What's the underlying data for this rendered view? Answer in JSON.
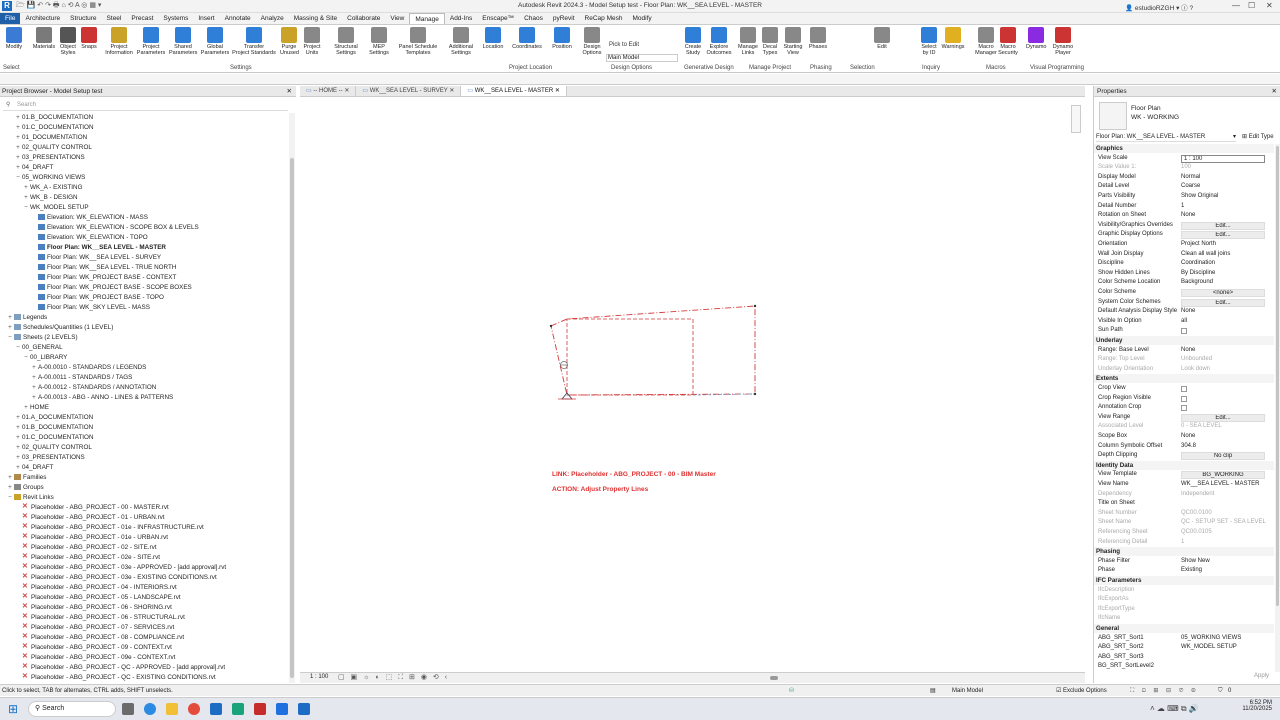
{
  "app": {
    "title": "Autodesk Revit 2024.3 - Model Setup test - Floor Plan: WK__SEA LEVEL - MASTER",
    "user": "estudioRZGH",
    "logo": "R"
  },
  "ribbon_tabs": [
    "File",
    "Architecture",
    "Structure",
    "Steel",
    "Precast",
    "Systems",
    "Insert",
    "Annotate",
    "Analyze",
    "Massing & Site",
    "Collaborate",
    "View",
    "Manage",
    "Add-Ins",
    "Enscape™",
    "Chaos",
    "pyRevit",
    "ReCap Mesh",
    "Modify"
  ],
  "ribbon_active": "Manage",
  "ribbon_buttons": [
    {
      "label": "Modify",
      "color": "#3a7bd5"
    },
    {
      "label": "Materials",
      "color": "#7a7a7a"
    },
    {
      "label": "Object\nStyles",
      "color": "#555"
    },
    {
      "label": "Snaps",
      "color": "#c33"
    },
    {
      "label": "Project\nInformation",
      "color": "#c9a227"
    },
    {
      "label": "Project\nParameters",
      "color": "#2f7ed8"
    },
    {
      "label": "Shared\nParameters",
      "color": "#2f7ed8"
    },
    {
      "label": "Global\nParameters",
      "color": "#2f7ed8"
    },
    {
      "label": "Transfer\nProject Standards",
      "color": "#2f7ed8"
    },
    {
      "label": "Purge\nUnused",
      "color": "#c9a227"
    },
    {
      "label": "Project\nUnits",
      "color": "#888"
    },
    {
      "label": "Structural\nSettings",
      "color": "#888"
    },
    {
      "label": "MEP\nSettings",
      "color": "#888"
    },
    {
      "label": "Panel Schedule\nTemplates",
      "color": "#888"
    },
    {
      "label": "Additional\nSettings",
      "color": "#888"
    },
    {
      "label": "Location",
      "color": "#2f7ed8"
    },
    {
      "label": "Coordinates",
      "color": "#2f7ed8"
    },
    {
      "label": "Position",
      "color": "#2f7ed8"
    },
    {
      "label": "Design\nOptions",
      "color": "#888"
    },
    {
      "label": "Create\nStudy",
      "color": "#2f7ed8"
    },
    {
      "label": "Explore\nOutcomes",
      "color": "#2f7ed8"
    },
    {
      "label": "Manage\nLinks",
      "color": "#888"
    },
    {
      "label": "Decal\nTypes",
      "color": "#888"
    },
    {
      "label": "Starting\nView",
      "color": "#888"
    },
    {
      "label": "Phases",
      "color": "#888"
    },
    {
      "label": "Edit",
      "color": "#888"
    },
    {
      "label": "Select\nby ID",
      "color": "#2f7ed8"
    },
    {
      "label": "Warnings",
      "color": "#e0b020"
    },
    {
      "label": "Macro\nManager",
      "color": "#888"
    },
    {
      "label": "Macro\nSecurity",
      "color": "#c33"
    },
    {
      "label": "Dynamo",
      "color": "#8a2be2"
    },
    {
      "label": "Dynamo\nPlayer",
      "color": "#c33"
    }
  ],
  "ribbon_extra": {
    "pick_to_edit": "Pick to Edit",
    "main_model": "Main Model"
  },
  "ribbon_panels": [
    "Select",
    "Settings",
    "Project Location",
    "Design Options",
    "Generative Design",
    "Manage Project",
    "Phasing",
    "Selection",
    "Inquiry",
    "Macros",
    "Visual Programming"
  ],
  "project_browser": {
    "title": "Project Browser - Model Setup test",
    "search_placeholder": "Search",
    "tree": [
      {
        "t": "01.B_DOCUMENTATION",
        "d": 1,
        "g": "+"
      },
      {
        "t": "01.C_DOCUMENTATION",
        "d": 1,
        "g": "+"
      },
      {
        "t": "01_DOCUMENTATION",
        "d": 1,
        "g": "+"
      },
      {
        "t": "02_QUALITY CONTROL",
        "d": 1,
        "g": "+"
      },
      {
        "t": "03_PRESENTATIONS",
        "d": 1,
        "g": "+"
      },
      {
        "t": "04_DRAFT",
        "d": 1,
        "g": "+"
      },
      {
        "t": "05_WORKING VIEWS",
        "d": 1,
        "g": "−"
      },
      {
        "t": "WK_A - EXISTING",
        "d": 2,
        "g": "+"
      },
      {
        "t": "WK_B - DESIGN",
        "d": 2,
        "g": "+"
      },
      {
        "t": "WK_MODEL SETUP",
        "d": 2,
        "g": "−"
      },
      {
        "t": "Elevation: WK_ELEVATION - MASS",
        "d": 4,
        "i": "view"
      },
      {
        "t": "Elevation: WK_ELEVATION - SCOPE BOX & LEVELS",
        "d": 4,
        "i": "view"
      },
      {
        "t": "Elevation: WK_ELEVATION - TOPO",
        "d": 4,
        "i": "view"
      },
      {
        "t": "Floor Plan: WK__SEA LEVEL - MASTER",
        "d": 4,
        "i": "view",
        "b": true
      },
      {
        "t": "Floor Plan: WK__SEA LEVEL - SURVEY",
        "d": 4,
        "i": "view"
      },
      {
        "t": "Floor Plan: WK__SEA LEVEL - TRUE NORTH",
        "d": 4,
        "i": "view"
      },
      {
        "t": "Floor Plan: WK_PROJECT BASE - CONTEXT",
        "d": 4,
        "i": "view"
      },
      {
        "t": "Floor Plan: WK_PROJECT BASE - SCOPE BOXES",
        "d": 4,
        "i": "view"
      },
      {
        "t": "Floor Plan: WK_PROJECT BASE - TOPO",
        "d": 4,
        "i": "view"
      },
      {
        "t": "Floor Plan: WK_SKY LEVEL - MASS",
        "d": 4,
        "i": "view"
      },
      {
        "t": "Legends",
        "d": 0,
        "g": "+",
        "i": "legend"
      },
      {
        "t": "Schedules/Quantities (1 LEVEL)",
        "d": 0,
        "g": "+",
        "i": "sched"
      },
      {
        "t": "Sheets (2 LEVELS)",
        "d": 0,
        "g": "−",
        "i": "sheet"
      },
      {
        "t": "00_GENERAL",
        "d": 1,
        "g": "−"
      },
      {
        "t": "00_LIBRARY",
        "d": 2,
        "g": "−"
      },
      {
        "t": "A-00.0010 - STANDARDS / LEGENDS",
        "d": 3,
        "g": "+"
      },
      {
        "t": "A-00.0011 - STANDARDS / TAGS",
        "d": 3,
        "g": "+"
      },
      {
        "t": "A-00.0012 - STANDARDS / ANNOTATION",
        "d": 3,
        "g": "+"
      },
      {
        "t": "A-00.0013 - ABG - ANNO - LINES & PATTERNS",
        "d": 3,
        "g": "+"
      },
      {
        "t": "HOME",
        "d": 2,
        "g": "+"
      },
      {
        "t": "01.A_DOCUMENTATION",
        "d": 1,
        "g": "+"
      },
      {
        "t": "01.B_DOCUMENTATION",
        "d": 1,
        "g": "+"
      },
      {
        "t": "01.C_DOCUMENTATION",
        "d": 1,
        "g": "+"
      },
      {
        "t": "02_QUALITY CONTROL",
        "d": 1,
        "g": "+"
      },
      {
        "t": "03_PRESENTATIONS",
        "d": 1,
        "g": "+"
      },
      {
        "t": "04_DRAFT",
        "d": 1,
        "g": "+"
      },
      {
        "t": "Families",
        "d": 0,
        "g": "+",
        "i": "fam"
      },
      {
        "t": "Groups",
        "d": 0,
        "g": "+",
        "i": "grp"
      },
      {
        "t": "Revit Links",
        "d": 0,
        "g": "−",
        "i": "link"
      },
      {
        "t": "Placeholder - ABG_PROJECT - 00 - MASTER.rvt",
        "d": 2,
        "i": "x"
      },
      {
        "t": "Placeholder - ABG_PROJECT - 01 - URBAN.rvt",
        "d": 2,
        "i": "x"
      },
      {
        "t": "Placeholder - ABG_PROJECT - 01e - INFRASTRUCTURE.rvt",
        "d": 2,
        "i": "x"
      },
      {
        "t": "Placeholder - ABG_PROJECT - 01e - URBAN.rvt",
        "d": 2,
        "i": "x"
      },
      {
        "t": "Placeholder - ABG_PROJECT - 02 - SITE.rvt",
        "d": 2,
        "i": "x"
      },
      {
        "t": "Placeholder - ABG_PROJECT - 02e - SITE.rvt",
        "d": 2,
        "i": "x"
      },
      {
        "t": "Placeholder - ABG_PROJECT - 03e - APPROVED - [add approval].rvt",
        "d": 2,
        "i": "x"
      },
      {
        "t": "Placeholder - ABG_PROJECT - 03e - EXISTING CONDITIONS.rvt",
        "d": 2,
        "i": "x"
      },
      {
        "t": "Placeholder - ABG_PROJECT - 04 - INTERIORS.rvt",
        "d": 2,
        "i": "x"
      },
      {
        "t": "Placeholder - ABG_PROJECT - 05 - LANDSCAPE.rvt",
        "d": 2,
        "i": "x"
      },
      {
        "t": "Placeholder - ABG_PROJECT - 06 - SHORING.rvt",
        "d": 2,
        "i": "x"
      },
      {
        "t": "Placeholder - ABG_PROJECT - 06 - STRUCTURAL.rvt",
        "d": 2,
        "i": "x"
      },
      {
        "t": "Placeholder - ABG_PROJECT - 07 - SERVICES.rvt",
        "d": 2,
        "i": "x"
      },
      {
        "t": "Placeholder - ABG_PROJECT - 08 - COMPLIANCE.rvt",
        "d": 2,
        "i": "x"
      },
      {
        "t": "Placeholder - ABG_PROJECT - 09 - CONTEXT.rvt",
        "d": 2,
        "i": "x"
      },
      {
        "t": "Placeholder - ABG_PROJECT - 09e - CONTEXT.rvt",
        "d": 2,
        "i": "x"
      },
      {
        "t": "Placeholder - ABG_PROJECT - QC - APPROVED - [add approval].rvt",
        "d": 2,
        "i": "x"
      },
      {
        "t": "Placeholder - ABG_PROJECT - QC - EXISTING CONDITIONS.rvt",
        "d": 2,
        "i": "x"
      }
    ]
  },
  "view_tabs": [
    {
      "label": "-- HOME --",
      "active": false
    },
    {
      "label": "WK__SEA LEVEL - SURVEY",
      "active": false
    },
    {
      "label": "WK__SEA LEVEL - MASTER",
      "active": true
    }
  ],
  "canvas": {
    "link_text": "LINK: Placeholder - ABG_PROJECT - 00 - BIM Master",
    "action_text": "ACTION: Adjust Property Lines",
    "scale": "1 : 100",
    "annotation_color": "#e03030"
  },
  "properties": {
    "title": "Properties",
    "type_family": "Floor Plan",
    "type_name": "WK - WORKING",
    "selector": "Floor Plan: WK__SEA LEVEL - MASTER",
    "edit_type": "Edit Type",
    "rows": [
      {
        "g": "Graphics"
      },
      {
        "k": "View Scale",
        "v": "1 : 100",
        "s": "box"
      },
      {
        "k": "Scale Value    1:",
        "v": "100",
        "dim": true
      },
      {
        "k": "Display Model",
        "v": "Normal"
      },
      {
        "k": "Detail Level",
        "v": "Coarse"
      },
      {
        "k": "Parts Visibility",
        "v": "Show Original"
      },
      {
        "k": "Detail Number",
        "v": "1"
      },
      {
        "k": "Rotation on Sheet",
        "v": "None"
      },
      {
        "k": "Visibility/Graphics Overrides",
        "v": "Edit...",
        "s": "btn"
      },
      {
        "k": "Graphic Display Options",
        "v": "Edit...",
        "s": "btn"
      },
      {
        "k": "Orientation",
        "v": "Project North"
      },
      {
        "k": "Wall Join Display",
        "v": "Clean all wall joins"
      },
      {
        "k": "Discipline",
        "v": "Coordination"
      },
      {
        "k": "Show Hidden Lines",
        "v": "By Discipline"
      },
      {
        "k": "Color Scheme Location",
        "v": "Background"
      },
      {
        "k": "Color Scheme",
        "v": "<none>",
        "s": "btn"
      },
      {
        "k": "System Color Schemes",
        "v": "Edit...",
        "s": "btn"
      },
      {
        "k": "Default Analysis Display Style",
        "v": "None"
      },
      {
        "k": "Visible In Option",
        "v": "all"
      },
      {
        "k": "Sun Path",
        "s": "chk"
      },
      {
        "g": "Underlay"
      },
      {
        "k": "Range: Base Level",
        "v": "None"
      },
      {
        "k": "Range: Top Level",
        "v": "Unbounded",
        "dim": true
      },
      {
        "k": "Underlay Orientation",
        "v": "Look down",
        "dim": true
      },
      {
        "g": "Extents"
      },
      {
        "k": "Crop View",
        "s": "chk"
      },
      {
        "k": "Crop Region Visible",
        "s": "chk"
      },
      {
        "k": "Annotation Crop",
        "s": "chk"
      },
      {
        "k": "View Range",
        "v": "Edit...",
        "s": "btn"
      },
      {
        "k": "Associated Level",
        "v": "0 - SEA LEVEL",
        "dim": true
      },
      {
        "k": "Scope Box",
        "v": "None"
      },
      {
        "k": "Column Symbolic Offset",
        "v": "304.8"
      },
      {
        "k": "Depth Clipping",
        "v": "No clip",
        "s": "btn"
      },
      {
        "g": "Identity Data"
      },
      {
        "k": "View Template",
        "v": "BG_WORKING",
        "s": "btn"
      },
      {
        "k": "View Name",
        "v": "WK__SEA LEVEL - MASTER"
      },
      {
        "k": "Dependency",
        "v": "Independent",
        "dim": true
      },
      {
        "k": "Title on Sheet",
        "v": ""
      },
      {
        "k": "Sheet Number",
        "v": "QC00.0100",
        "dim": true
      },
      {
        "k": "Sheet Name",
        "v": "QC - SETUP SET - SEA LEVEL",
        "dim": true
      },
      {
        "k": "Referencing Sheet",
        "v": "QC00.0105",
        "dim": true
      },
      {
        "k": "Referencing Detail",
        "v": "1",
        "dim": true
      },
      {
        "g": "Phasing"
      },
      {
        "k": "Phase Filter",
        "v": "Show New"
      },
      {
        "k": "Phase",
        "v": "Existing"
      },
      {
        "g": "IFC Parameters"
      },
      {
        "k": "IfcDescription",
        "v": "",
        "dim": true
      },
      {
        "k": "IfcExportAs",
        "v": "",
        "dim": true
      },
      {
        "k": "IfcExportType",
        "v": "",
        "dim": true
      },
      {
        "k": "IfcName",
        "v": "",
        "dim": true
      },
      {
        "g": "General"
      },
      {
        "k": "ABG_SRT_Sort1",
        "v": "05_WORKING VIEWS"
      },
      {
        "k": "ABG_SRT_Sort2",
        "v": "WK_MODEL SETUP"
      },
      {
        "k": "ABG_SRT_Sort3",
        "v": ""
      },
      {
        "k": "BG_SRT_SortLevel2",
        "v": ""
      }
    ],
    "apply": "Apply"
  },
  "status": {
    "hint": "Click to select, TAB for alternates, CTRL adds, SHIFT unselects.",
    "model": "Main Model",
    "exclude": "Exclude Options",
    "count": "0"
  },
  "taskbar": {
    "search": "Search",
    "time": "6:52 PM",
    "date": "11/20/2025"
  }
}
